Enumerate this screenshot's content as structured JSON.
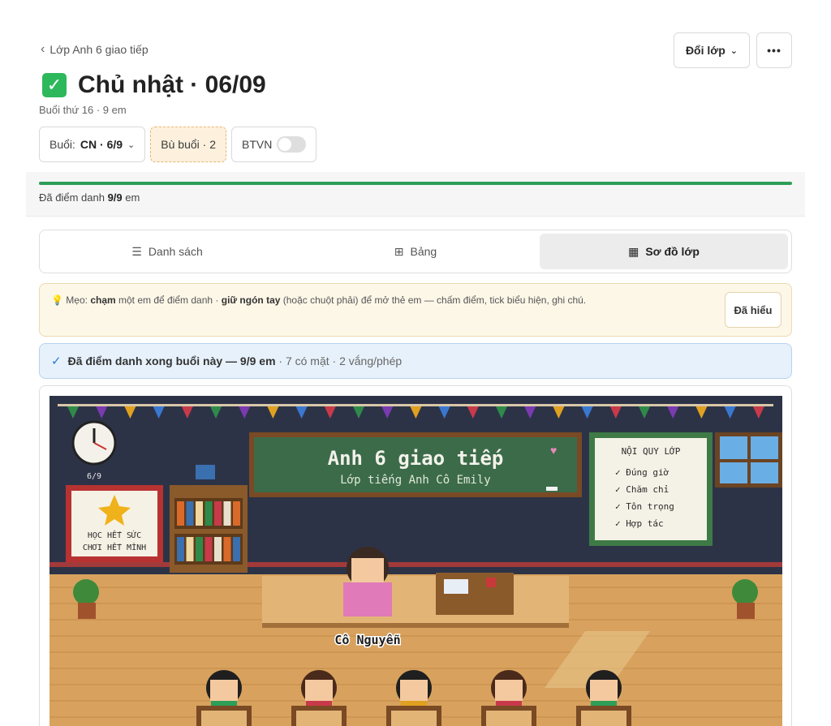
{
  "header": {
    "back_label": "Lớp Anh 6 giao tiếp",
    "switch_class_label": "Đổi lớp",
    "more_label": "•••",
    "title": "Chủ nhật · 06/09",
    "subtitle": "Buổi thứ 16 · 9 em"
  },
  "chips": {
    "session_prefix": "Buổi:",
    "session_value": "CN · 6/9",
    "makeup_label": "Bù buổi · 2",
    "homework_label": "BTVN",
    "homework_on": false
  },
  "progress": {
    "fraction": 1.0,
    "text_prefix": "Đã điểm danh",
    "count": "9/9",
    "text_suffix": "em"
  },
  "tabs": [
    {
      "label": "Danh sách",
      "icon": "list-icon",
      "active": false
    },
    {
      "label": "Bảng",
      "icon": "table-icon",
      "active": false
    },
    {
      "label": "Sơ đồ lớp",
      "icon": "grid-icon",
      "active": true
    }
  ],
  "tip": {
    "t1": "Mẹo: ",
    "b1": "chạm",
    "t2": " một em để điểm danh · ",
    "b2": "giữ ngón tay",
    "t3": " (hoặc chuột phải) để mở thẻ em — chấm điểm, tick biểu hiện, ghi chú.",
    "dismiss_label": "Đã hiểu"
  },
  "status": {
    "bold": "Đã điểm danh xong buổi này — 9/9 em",
    "rest": " · 7 có mặt · 2 vắng/phép"
  },
  "classroom": {
    "board_title": "Anh 6 giao tiếp",
    "board_subtitle": "Lớp tiếng Anh Cô Emily",
    "clock_date": "6/9",
    "poster_line1": "HỌC HẾT SỨC",
    "poster_line2": "CHƠI HẾT MÌNH",
    "rules_title": "NỘI QUY LỚP",
    "rules": [
      "Đúng giờ",
      "Chăm chỉ",
      "Tôn trọng",
      "Hợp tác"
    ],
    "teacher_name": "Cô Nguyễn",
    "colors": {
      "wall": "#2d3347",
      "board": "#3c6b4a",
      "floor": "#d8a25e",
      "teacher_dress": "#e07ab8"
    }
  }
}
